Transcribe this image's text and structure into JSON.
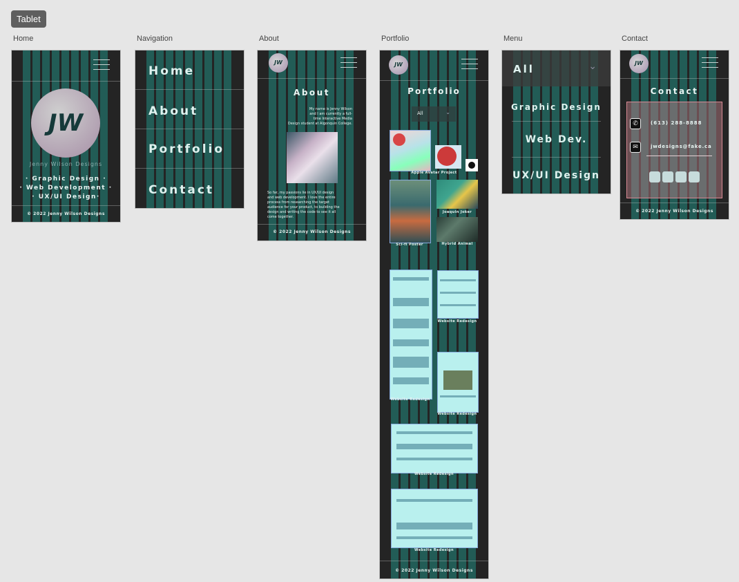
{
  "top_tag": "Tablet",
  "boards": {
    "home": {
      "label": "Home",
      "logo": "JW",
      "brand": "Jenny Wilson Designs",
      "service1": "· Graphic Design ·",
      "service2": "· Web Development ·",
      "service3": "· UX/UI Design·",
      "footer": "© 2022 Jenny Wilson Designs"
    },
    "navigation": {
      "label": "Navigation",
      "items": [
        "Home",
        "About",
        "Portfolio",
        "Contact"
      ]
    },
    "about": {
      "label": "About",
      "logo": "JW",
      "heading": "About",
      "intro1": "My name is Jenny Wilson",
      "intro2": "and I am currently a full-",
      "intro3": "time Interactive Media",
      "intro4": "Design student at Algonquin College.",
      "body1": "So far, my passions lie in UX/UI design",
      "body2": "and web development. I love the entire",
      "body3": "process from researching the target",
      "body4": "audience for your product, to building the",
      "body5": "design and writing the code to see it all",
      "body6": "come together.",
      "footer": "© 2022 Jenny Wilson Designs"
    },
    "portfolio": {
      "label": "Portfolio",
      "logo": "JW",
      "heading": "Portfolio",
      "filter_value": "All",
      "captions": {
        "apple": "Apple Avatar Project",
        "joker": "Joaquin Joker",
        "poster": "Sci-fi Poster",
        "hybrid": "Hybrid Animal",
        "redesign1": "Website Redesign",
        "redesign2": "Website Redesign",
        "redesign3": "Website Redesign",
        "redesign4": "Website Redesign",
        "redesign5": "Website Redesign"
      },
      "footer": "© 2022 Jenny Wilson Designs"
    },
    "menu": {
      "label": "Menu",
      "selected": "All",
      "items": [
        "Graphic Design",
        "Web Dev.",
        "UX/UI Design"
      ]
    },
    "contact": {
      "label": "Contact",
      "logo": "JW",
      "heading": "Contact",
      "phone": "(613) 288-8888",
      "email": "jwdesigns@fake.ca",
      "footer": "© 2022 Jenny Wilson Designs"
    }
  },
  "colors": {
    "board_bg": "#242424",
    "grid_column": "#1eaa9b",
    "accent_text": "#dff2ef",
    "thumb_bg": "#b9f0ee"
  }
}
